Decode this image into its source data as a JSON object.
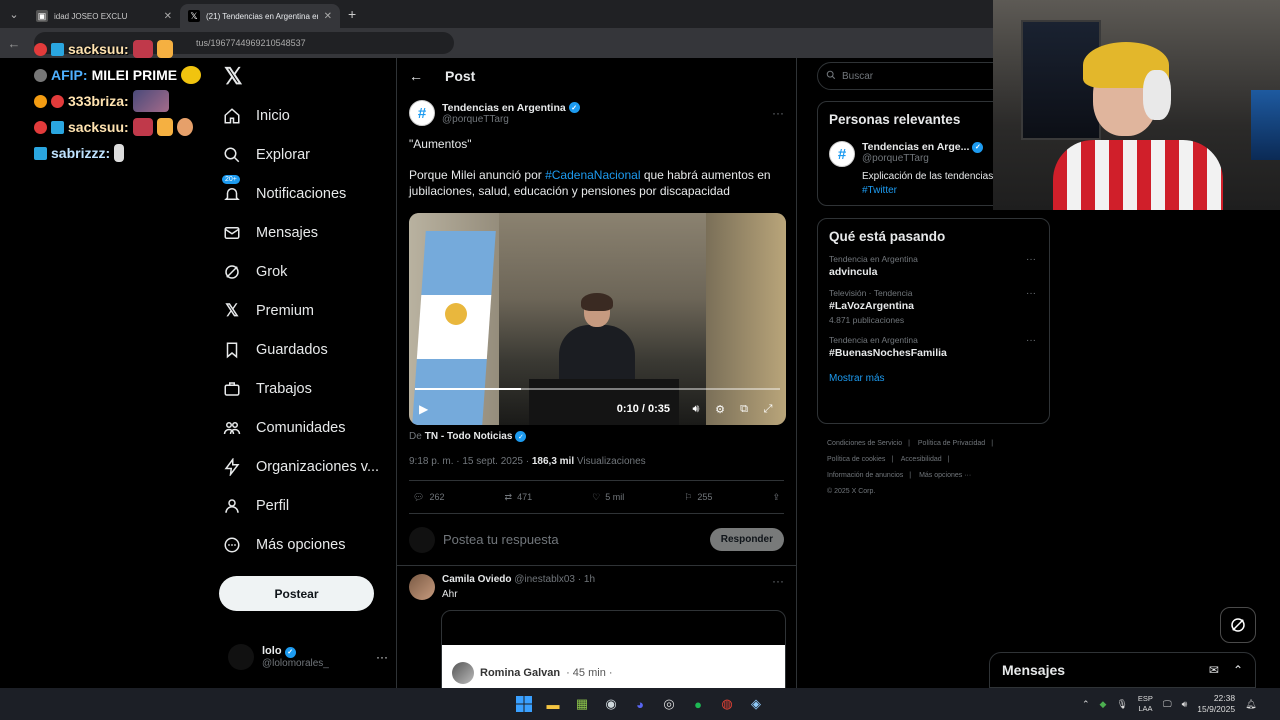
{
  "browser": {
    "tabs": [
      {
        "title": "idad JOSEO EXCLU"
      },
      {
        "title": "(21) Tendencias en Argentina en X"
      }
    ],
    "url_fragment": "tus/1967744969210548537"
  },
  "overlay_chat": [
    {
      "user": "sacksuu:",
      "msg": ""
    },
    {
      "user": "AFIP:",
      "msg": "MILEI PRIME"
    },
    {
      "user": "333briza:",
      "msg": ""
    },
    {
      "user": "sacksuu:",
      "msg": ""
    },
    {
      "user": "sabrizzz:",
      "msg": ""
    }
  ],
  "nav": {
    "items": [
      {
        "label": "Inicio",
        "icon": "home-icon"
      },
      {
        "label": "Explorar",
        "icon": "search-icon"
      },
      {
        "label": "Notificaciones",
        "icon": "bell-icon",
        "badge": "20+"
      },
      {
        "label": "Mensajes",
        "icon": "mail-icon"
      },
      {
        "label": "Grok",
        "icon": "grok-icon"
      },
      {
        "label": "Premium",
        "icon": "x-icon"
      },
      {
        "label": "Guardados",
        "icon": "bookmark-icon"
      },
      {
        "label": "Trabajos",
        "icon": "briefcase-icon"
      },
      {
        "label": "Comunidades",
        "icon": "people-icon"
      },
      {
        "label": "Organizaciones v...",
        "icon": "lightning-icon"
      },
      {
        "label": "Perfil",
        "icon": "user-icon"
      },
      {
        "label": "Más opciones",
        "icon": "more-circle-icon"
      }
    ],
    "post_button": "Postear",
    "account": {
      "name": "lolo",
      "handle": "@lolomorales_"
    }
  },
  "main": {
    "header": "Post",
    "tweet": {
      "author_name": "Tendencias en Argentina",
      "author_handle": "@porqueTTarg",
      "line1": "\"Aumentos\"",
      "line2_pre": "Porque Milei anunció por ",
      "line2_hashtag": "#CadenaNacional",
      "line2_post": " que habrá aumentos en jubilaciones, salud, educación y pensiones por discapacidad",
      "video": {
        "time": "0:10 / 0:35",
        "progress": 0.29
      },
      "source_prefix": "De",
      "source_name": "TN - Todo Noticias",
      "timestamp": "9:18 p. m. · 15 sept. 2025 ·",
      "views_count": "186,3 mil",
      "views_label": "Visualizaciones",
      "stats": {
        "replies": "262",
        "reposts": "471",
        "likes": "5 mil",
        "bookmarks": "255"
      }
    },
    "reply_placeholder": "Postea tu respuesta",
    "reply_button": "Responder",
    "reply": {
      "name": "Camila Oviedo",
      "handle": "@inestablx03 · 1h",
      "text": "Ahr",
      "quoted_name": "Romina Galvan",
      "quoted_time": "· 45 min ·"
    }
  },
  "right": {
    "search_placeholder": "Buscar",
    "relevant": {
      "title": "Personas relevantes",
      "name": "Tendencias en Arge...",
      "handle": "@porqueTTarg",
      "bio": "Explicación de las tendencias",
      "bio_tag": "#Twitter"
    },
    "trends": {
      "title": "Qué está pasando",
      "items": [
        {
          "context": "Tendencia en Argentina",
          "topic": "advincula",
          "count": ""
        },
        {
          "context": "Televisión · Tendencia",
          "topic": "#LaVozArgentina",
          "count": "4.871 publicaciones"
        },
        {
          "context": "Tendencia en Argentina",
          "topic": "#BuenasNochesFamilia",
          "count": ""
        }
      ],
      "show_more": "Mostrar más"
    },
    "footer": [
      "Condiciones de Servicio",
      "Política de Privacidad",
      "Política de cookies",
      "Accesibilidad",
      "Información de anuncios",
      "Más opciones ···",
      "© 2025 X Corp."
    ]
  },
  "messages_drawer": "Mensajes",
  "taskbar": {
    "lang_top": "ESP",
    "lang_bottom": "LAA",
    "time": "22:38",
    "date": "15/9/2025"
  },
  "colors": {
    "accent": "#1d9bf0",
    "background": "#000000",
    "border": "#2f3336",
    "muted": "#71767b"
  }
}
